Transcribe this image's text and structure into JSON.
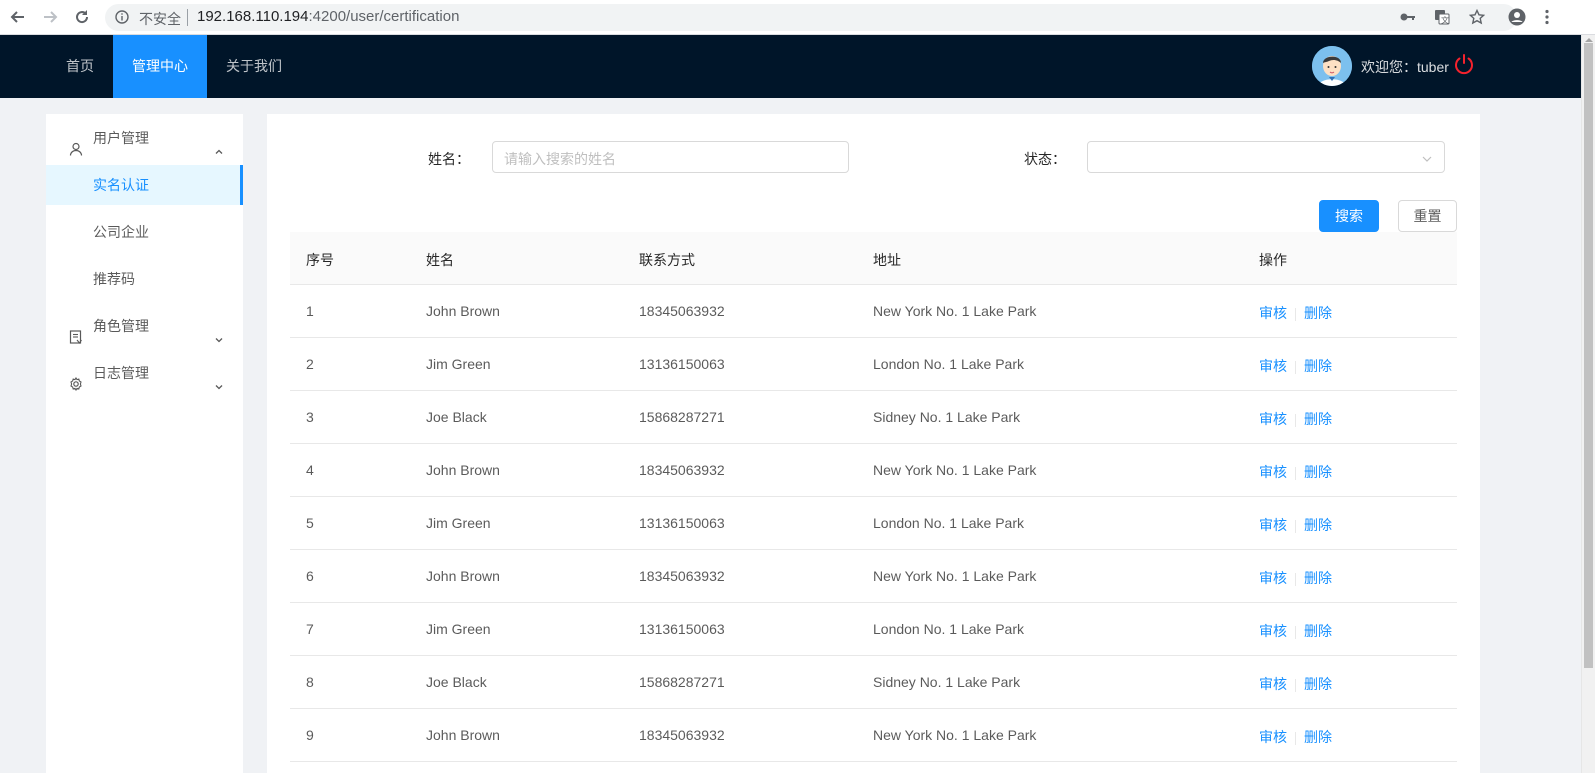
{
  "browser": {
    "security_label": "不安全",
    "url_host": "192.168.110.194",
    "url_rest": ":4200/user/certification"
  },
  "header": {
    "menu": [
      {
        "label": "首页"
      },
      {
        "label": "管理中心",
        "active": true
      },
      {
        "label": "关于我们"
      }
    ],
    "welcome": "欢迎您：tuber"
  },
  "sidebar": {
    "groups": [
      {
        "label": "用户管理",
        "icon": "user-icon",
        "expanded": true,
        "children": [
          {
            "label": "实名认证",
            "selected": true
          },
          {
            "label": "公司企业"
          },
          {
            "label": "推荐码"
          }
        ]
      },
      {
        "label": "角色管理",
        "icon": "id-card-icon",
        "expanded": false
      },
      {
        "label": "日志管理",
        "icon": "gear-icon",
        "expanded": false
      }
    ]
  },
  "search": {
    "name_label": "姓名：",
    "name_placeholder": "请输入搜索的姓名",
    "status_label": "状态：",
    "status_value": "",
    "search_button": "搜索",
    "reset_button": "重置"
  },
  "table": {
    "columns": [
      "序号",
      "姓名",
      "联系方式",
      "地址",
      "操作"
    ],
    "actions": {
      "review": "审核",
      "delete": "删除"
    },
    "rows": [
      {
        "no": "1",
        "name": "John Brown",
        "phone": "18345063932",
        "address": "New York No. 1 Lake Park"
      },
      {
        "no": "2",
        "name": "Jim Green",
        "phone": "13136150063",
        "address": "London No. 1 Lake Park"
      },
      {
        "no": "3",
        "name": "Joe Black",
        "phone": "15868287271",
        "address": "Sidney No. 1 Lake Park"
      },
      {
        "no": "4",
        "name": "John Brown",
        "phone": "18345063932",
        "address": "New York No. 1 Lake Park"
      },
      {
        "no": "5",
        "name": "Jim Green",
        "phone": "13136150063",
        "address": "London No. 1 Lake Park"
      },
      {
        "no": "6",
        "name": "John Brown",
        "phone": "18345063932",
        "address": "New York No. 1 Lake Park"
      },
      {
        "no": "7",
        "name": "Jim Green",
        "phone": "13136150063",
        "address": "London No. 1 Lake Park"
      },
      {
        "no": "8",
        "name": "Joe Black",
        "phone": "15868287271",
        "address": "Sidney No. 1 Lake Park"
      },
      {
        "no": "9",
        "name": "John Brown",
        "phone": "18345063932",
        "address": "New York No. 1 Lake Park"
      }
    ]
  },
  "colors": {
    "header_bg": "#001529",
    "primary": "#1890ff",
    "page_bg": "#f0f2f5",
    "logout_icon": "#f5222d"
  }
}
